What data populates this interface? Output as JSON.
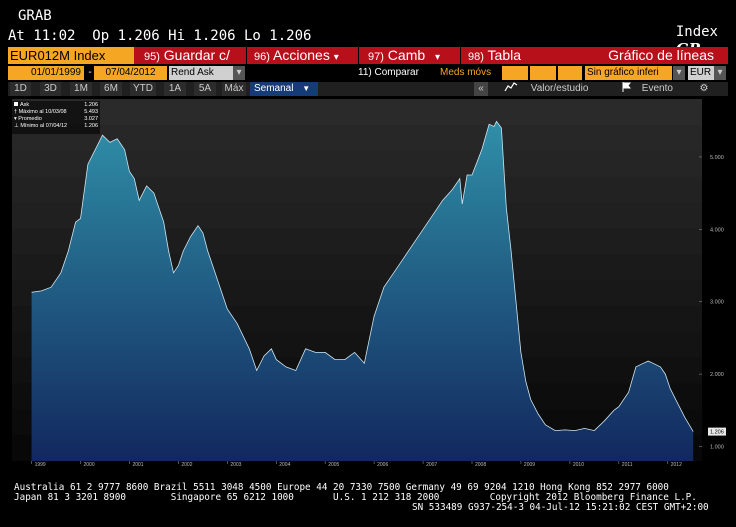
{
  "header": {
    "screen_name": "GRAB",
    "quote_line": "At 11:02  Op 1.206 Hi 1.206 Lo 1.206",
    "index_label": "Index",
    "index_func": "GP"
  },
  "menu": {
    "ticker": "EUR012M Index",
    "items": [
      {
        "num": "95)",
        "label": "Guardar c/"
      },
      {
        "num": "96)",
        "label": "Acciones",
        "arrow": "▾"
      },
      {
        "num": "97)",
        "label": "Camb",
        "arrow": "▾"
      },
      {
        "num": "98)",
        "label": "Tabla"
      }
    ],
    "chart_type": "Gráfico de líneas"
  },
  "controls": {
    "start_date": "01/01/1999",
    "dash": "-",
    "end_date": "07/04/2012",
    "price_type": "Rend Ask",
    "compare": "11) Comparar",
    "moving_avg": "Meds móvs",
    "secondary": "Sin gráfico inferi",
    "currency": "EUR"
  },
  "periods": {
    "items": [
      "1D",
      "3D",
      "1M",
      "6M",
      "YTD",
      "1A",
      "5A",
      "Máx"
    ],
    "frequency": "Semanal",
    "arrow": "▼",
    "collapse": "«",
    "value_study": "Valor/estudio",
    "event": "Evento",
    "settings_glyph": "⚙"
  },
  "legend": {
    "rows": [
      {
        "label": "Ask",
        "value": "1.206"
      },
      {
        "label": "Máximo al 10/03/08",
        "value": "5.493"
      },
      {
        "label": "Promedio",
        "value": "3.027"
      },
      {
        "label": "Mínimo al 07/04/12",
        "value": "1.206"
      }
    ]
  },
  "chart_data": {
    "type": "area",
    "y_ticks": [
      "5.000",
      "4.000",
      "3.000",
      "2.000",
      "1.000"
    ],
    "ylim": [
      0.8,
      5.8
    ],
    "x_ticks": [
      "1999",
      "2000",
      "2001",
      "2002",
      "2003",
      "2004",
      "2005",
      "2006",
      "2007",
      "2008",
      "2009",
      "2010",
      "2011",
      "2012"
    ],
    "last_value_label": "1.206",
    "series": [
      {
        "x": [
          1999.0,
          1999.2,
          1999.4,
          1999.6,
          1999.75,
          1999.9,
          2000.0,
          2000.15,
          2000.3,
          2000.45,
          2000.6,
          2000.75,
          2000.9,
          2001.0,
          2001.1,
          2001.2,
          2001.35,
          2001.5,
          2001.6,
          2001.7,
          2001.8,
          2001.9,
          2002.0,
          2002.1,
          2002.25,
          2002.4,
          2002.5,
          2002.6,
          2002.75,
          2002.9,
          2003.0,
          2003.2,
          2003.45,
          2003.6,
          2003.75,
          2003.9,
          2004.0,
          2004.2,
          2004.4,
          2004.6,
          2004.8,
          2005.0,
          2005.2,
          2005.4,
          2005.6,
          2005.8,
          2006.0,
          2006.2,
          2006.4,
          2006.6,
          2006.8,
          2007.0,
          2007.2,
          2007.4,
          2007.6,
          2007.75,
          2007.8,
          2007.9,
          2008.0,
          2008.2,
          2008.35,
          2008.45,
          2008.5,
          2008.6,
          2008.7,
          2008.8,
          2008.9,
          2009.0,
          2009.1,
          2009.2,
          2009.35,
          2009.5,
          2009.7,
          2009.9,
          2010.1,
          2010.3,
          2010.5,
          2010.7,
          2010.9,
          2011.0,
          2011.2,
          2011.35,
          2011.5,
          2011.6,
          2011.7,
          2011.85,
          2011.95,
          2012.05,
          2012.2,
          2012.35,
          2012.52
        ],
        "values": [
          3.13,
          3.15,
          3.2,
          3.4,
          3.7,
          4.1,
          4.15,
          4.9,
          5.1,
          5.3,
          5.2,
          5.25,
          5.1,
          4.8,
          4.7,
          4.4,
          4.6,
          4.5,
          4.3,
          4.1,
          3.7,
          3.4,
          3.5,
          3.7,
          3.9,
          4.05,
          3.95,
          3.7,
          3.4,
          3.1,
          2.9,
          2.7,
          2.35,
          2.05,
          2.25,
          2.35,
          2.2,
          2.1,
          2.05,
          2.35,
          2.3,
          2.3,
          2.2,
          2.2,
          2.3,
          2.15,
          2.8,
          3.2,
          3.4,
          3.6,
          3.8,
          4.0,
          4.2,
          4.4,
          4.55,
          4.7,
          4.35,
          4.75,
          4.75,
          5.1,
          5.45,
          5.42,
          5.49,
          5.4,
          4.3,
          3.7,
          3.0,
          2.3,
          1.9,
          1.65,
          1.45,
          1.3,
          1.22,
          1.23,
          1.22,
          1.25,
          1.22,
          1.35,
          1.5,
          1.55,
          1.75,
          2.1,
          2.15,
          2.18,
          2.15,
          2.1,
          2.0,
          1.8,
          1.6,
          1.4,
          1.206
        ]
      }
    ]
  },
  "footer": {
    "line1": "Australia 61 2 9777 8600 Brazil 5511 3048 4500 Europe 44 20 7330 7500 Germany 49 69 9204 1210 Hong Kong 852 2977 6000",
    "line2": "Japan 81 3 3201 8900        Singapore 65 6212 1000       U.S. 1 212 318 2000         Copyright 2012 Bloomberg Finance L.P.",
    "line3": "SN 533489 G937-254-3 04-Jul-12 15:21:02 CEST GMT+2:00"
  },
  "colors": {
    "menu_red": "#b8101a",
    "amber": "#f5a623",
    "selected_blue": "#163c78",
    "area_top": "#2f8fa8",
    "area_bottom": "#12285e"
  }
}
